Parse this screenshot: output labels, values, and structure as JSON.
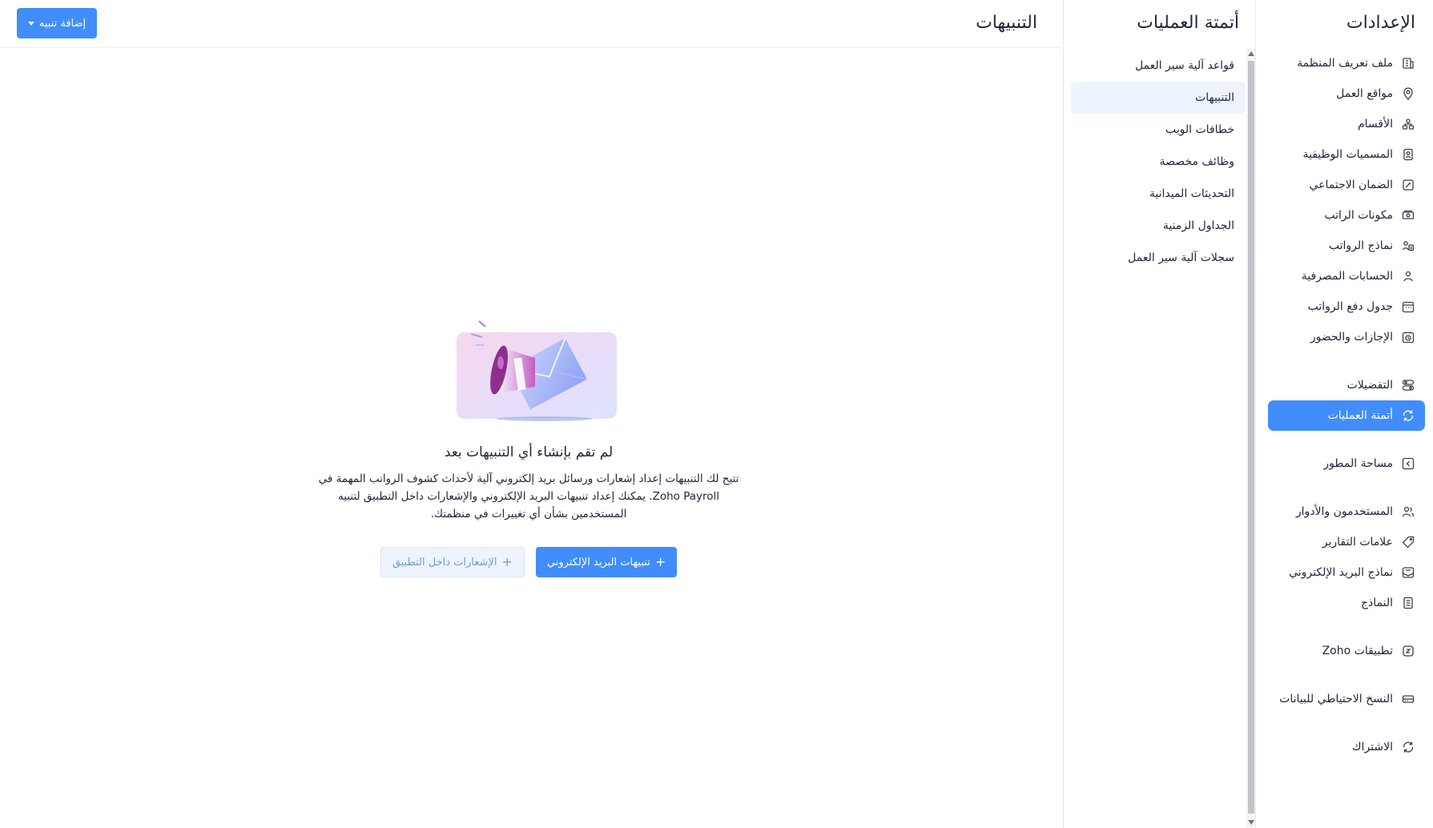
{
  "settings": {
    "title": "الإعدادات",
    "items": [
      {
        "label": "ملف تعريف المنظمة",
        "icon": "building-icon"
      },
      {
        "label": "مواقع العمل",
        "icon": "location-pin-icon"
      },
      {
        "label": "الأقسام",
        "icon": "org-chart-icon"
      },
      {
        "label": "المسميات الوظيفية",
        "icon": "id-badge-icon"
      },
      {
        "label": "الضمان الاجتماعي",
        "icon": "shield-tool-icon"
      },
      {
        "label": "مكونات الراتب",
        "icon": "money-icon"
      },
      {
        "label": "نماذج الرواتب",
        "icon": "user-list-icon"
      },
      {
        "label": "الحسابات المصرفية",
        "icon": "user-bank-icon"
      },
      {
        "label": "جدول دفع الرواتب",
        "icon": "calendar-icon"
      },
      {
        "label": "الإجازات والحضور",
        "icon": "calendar-clock-icon"
      },
      {
        "label": "التفضيلات",
        "icon": "preferences-icon"
      },
      {
        "label": "أتمتة العمليات",
        "icon": "automation-icon",
        "active": true
      },
      {
        "label": "مساحة المطور",
        "icon": "code-icon"
      },
      {
        "label": "المستخدمون والأدوار",
        "icon": "users-icon"
      },
      {
        "label": "علامات التقارير",
        "icon": "tag-icon"
      },
      {
        "label": "نماذج البريد الإلكتروني",
        "icon": "mail-template-icon"
      },
      {
        "label": "النماذج",
        "icon": "document-icon"
      },
      {
        "label": "تطبيقات Zoho",
        "icon": "zoho-apps-icon"
      },
      {
        "label": "النسخ الاحتياطي للبيانات",
        "icon": "backup-icon"
      },
      {
        "label": "الاشتراك",
        "icon": "subscription-icon"
      }
    ]
  },
  "automation": {
    "title": "أتمتة العمليات",
    "items": [
      {
        "label": "قواعد آلية سير العمل"
      },
      {
        "label": "التنبيهات",
        "active": true
      },
      {
        "label": "خطافات الويب"
      },
      {
        "label": "وظائف مخصصة"
      },
      {
        "label": "التحديثات الميدانية"
      },
      {
        "label": "الجداول الزمنية"
      },
      {
        "label": "سجلات آلية سير العمل"
      }
    ]
  },
  "main": {
    "title": "التنبيهات",
    "add_button": "إضافة تنبيه",
    "empty": {
      "title": "لم تقم بإنشاء أي التنبيهات بعد",
      "description": "تتيح لك التنبيهات إعداد إشعارات ورسائل بريد إلكتروني آلية لأحداث كشوف الرواتب المهمة في Zoho Payroll. يمكنك إعداد تنبيهات البريد الإلكتروني والإشعارات داخل التطبيق لتنبيه المستخدمين بشأن أي تغييرات في منظمتك.",
      "email_button": "تنبيهات البريد الإلكتروني",
      "inapp_button": "الإشعارات داخل التطبيق"
    }
  },
  "colors": {
    "accent": "#408dfb",
    "active_light": "#eef4fe"
  }
}
